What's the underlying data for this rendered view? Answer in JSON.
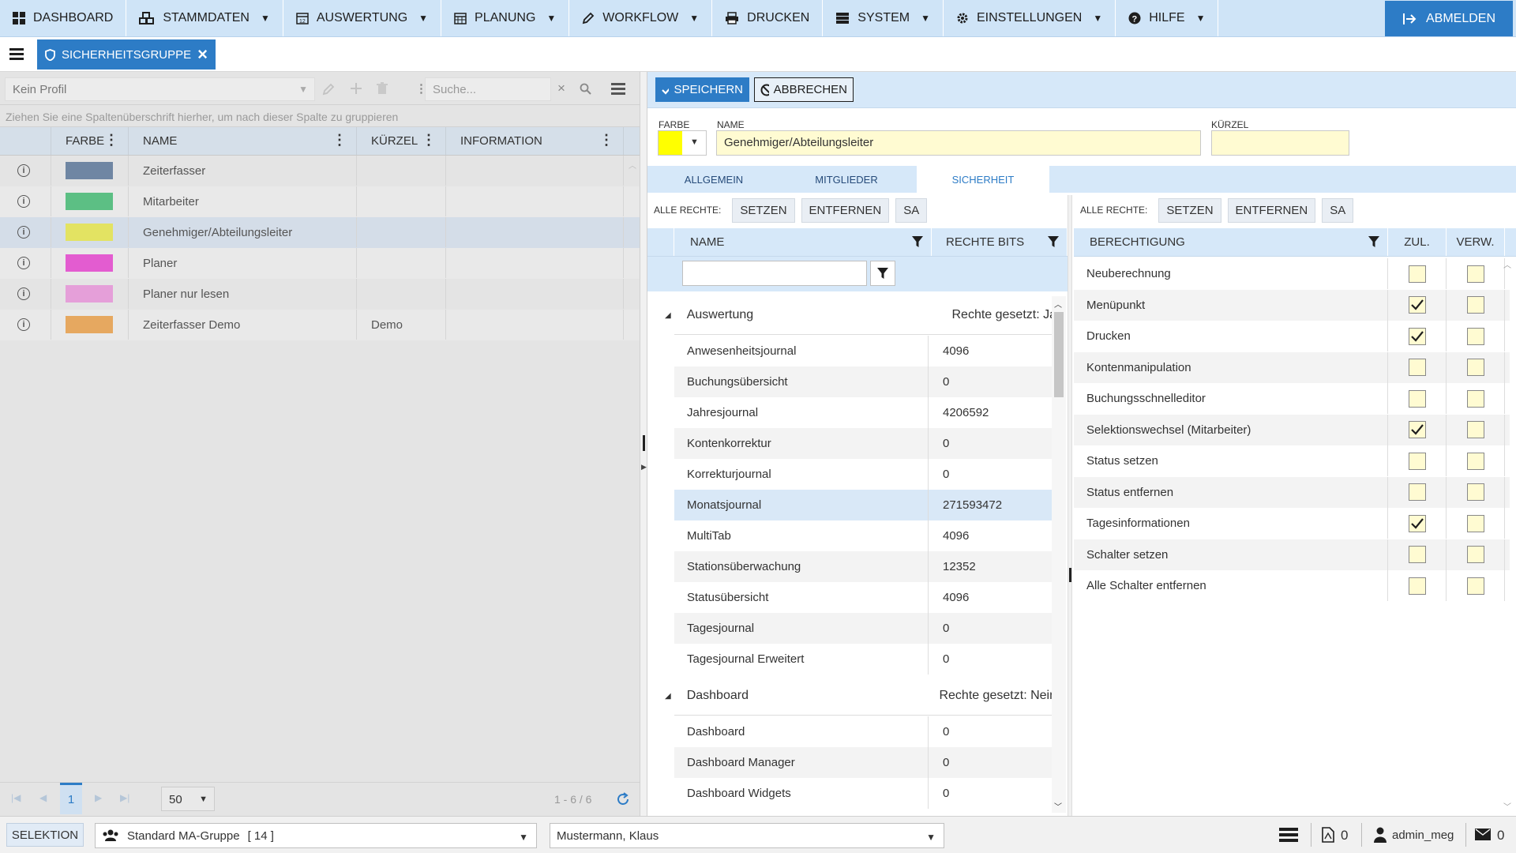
{
  "nav": {
    "items": [
      {
        "label": "DASHBOARD",
        "icon": "grid-icon",
        "caret": false
      },
      {
        "label": "STAMMDATEN",
        "icon": "cubes-icon",
        "caret": true
      },
      {
        "label": "AUSWERTUNG",
        "icon": "calendar-12-icon",
        "caret": true
      },
      {
        "label": "PLANUNG",
        "icon": "calendar-icon",
        "caret": true
      },
      {
        "label": "WORKFLOW",
        "icon": "pencil-icon",
        "caret": true
      },
      {
        "label": "DRUCKEN",
        "icon": "printer-icon",
        "caret": false
      },
      {
        "label": "SYSTEM",
        "icon": "server-icon",
        "caret": true
      },
      {
        "label": "EINSTELLUNGEN",
        "icon": "gear-icon",
        "caret": true
      },
      {
        "label": "HILFE",
        "icon": "question-icon",
        "caret": true
      }
    ],
    "logout": "ABMELDEN"
  },
  "tabbar": {
    "tab_label": "SICHERHEITSGRUPPE"
  },
  "left": {
    "profile": "Kein Profil",
    "search_placeholder": "Suche...",
    "group_hint": "Ziehen Sie eine Spaltenüberschrift hierher, um nach dieser Spalte zu gruppieren",
    "columns": {
      "farbe": "FARBE",
      "name": "NAME",
      "kuerzel": "KÜRZEL",
      "information": "INFORMATION"
    },
    "rows": [
      {
        "color": "#6f86a3",
        "name": "Zeiterfasser",
        "kuerzel": "",
        "info": ""
      },
      {
        "color": "#5cbf84",
        "name": "Mitarbeiter",
        "kuerzel": "",
        "info": ""
      },
      {
        "color": "#e3e362",
        "name": "Genehmiger/Abteilungsleiter",
        "kuerzel": "",
        "info": ""
      },
      {
        "color": "#e35cd0",
        "name": "Planer",
        "kuerzel": "",
        "info": ""
      },
      {
        "color": "#e59fd9",
        "name": "Planer nur lesen",
        "kuerzel": "",
        "info": ""
      },
      {
        "color": "#e6a860",
        "name": "Zeiterfasser Demo",
        "kuerzel": "Demo",
        "info": ""
      }
    ],
    "pager": {
      "page": "1",
      "page_size": "50",
      "range": "1 - 6 / 6"
    }
  },
  "form": {
    "save": "SPEICHERN",
    "cancel": "ABBRECHEN",
    "farbe_label": "FARBE",
    "farbe_value": "#ffff00",
    "name_label": "NAME",
    "name_value": "Genehmiger/Abteilungsleiter",
    "kuerzel_label": "KÜRZEL",
    "kuerzel_value": ""
  },
  "subtabs": [
    "ALLGEMEIN",
    "MITGLIEDER",
    "SICHERHEIT"
  ],
  "security": {
    "all_rights_label": "ALLE RECHTE:",
    "buttons": [
      "SETZEN",
      "ENTFERNEN",
      "SA"
    ],
    "modules_columns": {
      "name": "NAME",
      "bits": "RECHTE BITS"
    },
    "groups": [
      {
        "name": "Auswertung",
        "status": "Rechte gesetzt: Ja",
        "items": [
          {
            "name": "Anwesenheitsjournal",
            "bits": "4096"
          },
          {
            "name": "Buchungsübersicht",
            "bits": "0"
          },
          {
            "name": "Jahresjournal",
            "bits": "4206592"
          },
          {
            "name": "Kontenkorrektur",
            "bits": "0"
          },
          {
            "name": "Korrekturjournal",
            "bits": "0"
          },
          {
            "name": "Monatsjournal",
            "bits": "271593472"
          },
          {
            "name": "MultiTab",
            "bits": "4096"
          },
          {
            "name": "Stationsüberwachung",
            "bits": "12352"
          },
          {
            "name": "Statusübersicht",
            "bits": "4096"
          },
          {
            "name": "Tagesjournal",
            "bits": "0"
          },
          {
            "name": "Tagesjournal Erweitert",
            "bits": "0"
          }
        ]
      },
      {
        "name": "Dashboard",
        "status": "Rechte gesetzt: Nein",
        "items": [
          {
            "name": "Dashboard",
            "bits": "0"
          },
          {
            "name": "Dashboard Manager",
            "bits": "0"
          },
          {
            "name": "Dashboard Widgets",
            "bits": "0"
          }
        ]
      }
    ],
    "perm_columns": {
      "name": "BERECHTIGUNG",
      "allow": "ZUL.",
      "deny": "VERW."
    },
    "permissions": [
      {
        "name": "Neuberechnung",
        "allow": false,
        "deny": false
      },
      {
        "name": "Menüpunkt",
        "allow": true,
        "deny": false
      },
      {
        "name": "Drucken",
        "allow": true,
        "deny": false
      },
      {
        "name": "Kontenmanipulation",
        "allow": false,
        "deny": false
      },
      {
        "name": "Buchungsschnelleditor",
        "allow": false,
        "deny": false
      },
      {
        "name": "Selektionswechsel (Mitarbeiter)",
        "allow": true,
        "deny": false
      },
      {
        "name": "Status setzen",
        "allow": false,
        "deny": false
      },
      {
        "name": "Status entfernen",
        "allow": false,
        "deny": false
      },
      {
        "name": "Tagesinformationen",
        "allow": true,
        "deny": false
      },
      {
        "name": "Schalter setzen",
        "allow": false,
        "deny": false
      },
      {
        "name": "Alle Schalter entfernen",
        "allow": false,
        "deny": false
      }
    ]
  },
  "status": {
    "selektion": "SELEKTION",
    "group": "Standard MA-Gruppe",
    "group_count": "[ 14 ]",
    "employee": "Mustermann, Klaus",
    "pdf_count": "0",
    "user": "admin_meg",
    "mail_count": "0"
  }
}
